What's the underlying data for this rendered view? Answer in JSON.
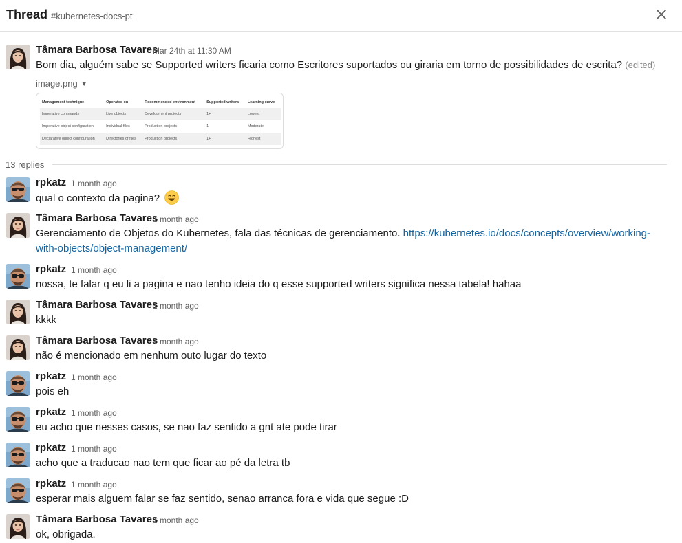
{
  "header": {
    "title": "Thread",
    "channel": "#kubernetes-docs-pt"
  },
  "parent": {
    "author": "Tâmara Barbosa Tavares",
    "timestamp": "Mar 24th at 11:30 AM",
    "text": "Bom dia, alguém sabe se Supported writers ficaria como Escritores suportados ou giraria em torno de possibilidades de escrita?",
    "edited": "(edited)",
    "attachment": {
      "filename": "image.png",
      "table": {
        "headers": [
          "Management technique",
          "Operates on",
          "Recommended environment",
          "Supported writers",
          "Learning curve"
        ],
        "rows": [
          [
            "Imperative commands",
            "Live objects",
            "Development projects",
            "1+",
            "Lowest"
          ],
          [
            "Imperative object configuration",
            "Individual files",
            "Production projects",
            "1",
            "Moderate"
          ],
          [
            "Declarative object configuration",
            "Directories of files",
            "Production projects",
            "1+",
            "Highest"
          ]
        ]
      }
    }
  },
  "replies_count": "13 replies",
  "replies": [
    {
      "author": "rpkatz",
      "time": "1 month ago",
      "text": "qual o contexto da pagina?",
      "emoji": "smile-emoji"
    },
    {
      "author": "Tâmara Barbosa Tavares",
      "time": "1 month ago",
      "text": "Gerenciamento de Objetos do Kubernetes, fala das técnicas de gerenciamento.",
      "link_line1": "https://kubernetes.io/docs/concepts/overview/working-",
      "link_line2": "with-objects/object-management/"
    },
    {
      "author": "rpkatz",
      "time": "1 month ago",
      "text": "nossa, te falar q eu li a pagina e nao tenho ideia do q esse supported writers significa nessa tabela! hahaa"
    },
    {
      "author": "Tâmara Barbosa Tavares",
      "time": "1 month ago",
      "text": "kkkk"
    },
    {
      "author": "Tâmara Barbosa Tavares",
      "time": "1 month ago",
      "text": "não é mencionado em nenhum outo lugar do texto"
    },
    {
      "author": "rpkatz",
      "time": "1 month ago",
      "text": "pois eh"
    },
    {
      "author": "rpkatz",
      "time": "1 month ago",
      "text": "eu acho que nesses casos, se nao faz sentido a gnt ate pode tirar"
    },
    {
      "author": "rpkatz",
      "time": "1 month ago",
      "text": "acho que a traducao nao tem que ficar ao pé da letra tb"
    },
    {
      "author": "rpkatz",
      "time": "1 month ago",
      "text": "esperar mais alguem falar se faz sentido, senao arranca fora e vida que segue :D"
    },
    {
      "author": "Tâmara Barbosa Tavares",
      "time": "1 month ago",
      "text": "ok, obrigada."
    }
  ],
  "icons": {
    "close": "close-icon",
    "caret": "caret-down-icon"
  }
}
